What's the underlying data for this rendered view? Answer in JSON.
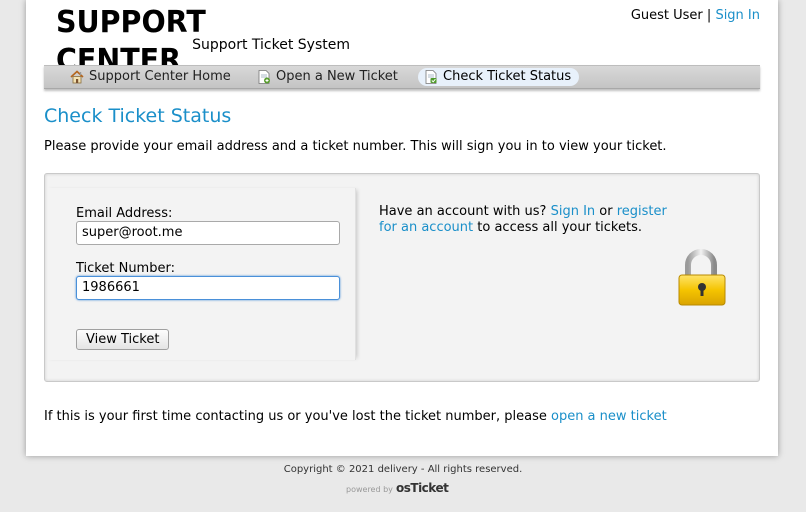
{
  "header": {
    "logo_title": "SUPPORT CENTER",
    "logo_subtitle": "Support Ticket System",
    "user_label": "Guest User",
    "separator": "|",
    "sign_in": "Sign In"
  },
  "nav": {
    "items": [
      {
        "label": "Support Center Home",
        "icon": "home-icon",
        "active": false
      },
      {
        "label": "Open a New Ticket",
        "icon": "new-ticket-icon",
        "active": false
      },
      {
        "label": "Check Ticket Status",
        "icon": "ticket-status-icon",
        "active": true
      }
    ]
  },
  "page": {
    "title": "Check Ticket Status",
    "intro": "Please provide your email address and a ticket number. This will sign you in to view your ticket."
  },
  "form": {
    "email_label": "Email Address:",
    "email_value": "super@root.me",
    "ticket_label": "Ticket Number:",
    "ticket_value": "1986661",
    "submit_label": "View Ticket"
  },
  "info": {
    "prefix": "Have an account with us? ",
    "sign_in": "Sign In",
    "or": " or ",
    "register": "register for an account",
    "suffix": " to access all your tickets.",
    "icon": "lock-icon"
  },
  "footer_note": {
    "text": "If this is your first time contacting us or you've lost the ticket number, please ",
    "link": "open a new ticket"
  },
  "footer": {
    "copyright": "Copyright © 2021 delivery - All rights reserved.",
    "powered_by": "powered by",
    "brand": "osTicket"
  },
  "colors": {
    "accent": "#1a8fc9",
    "nav_active_bg": "#e8f1fb",
    "panel_bg": "#f3f3f3",
    "page_bg": "#e9e9e9"
  }
}
